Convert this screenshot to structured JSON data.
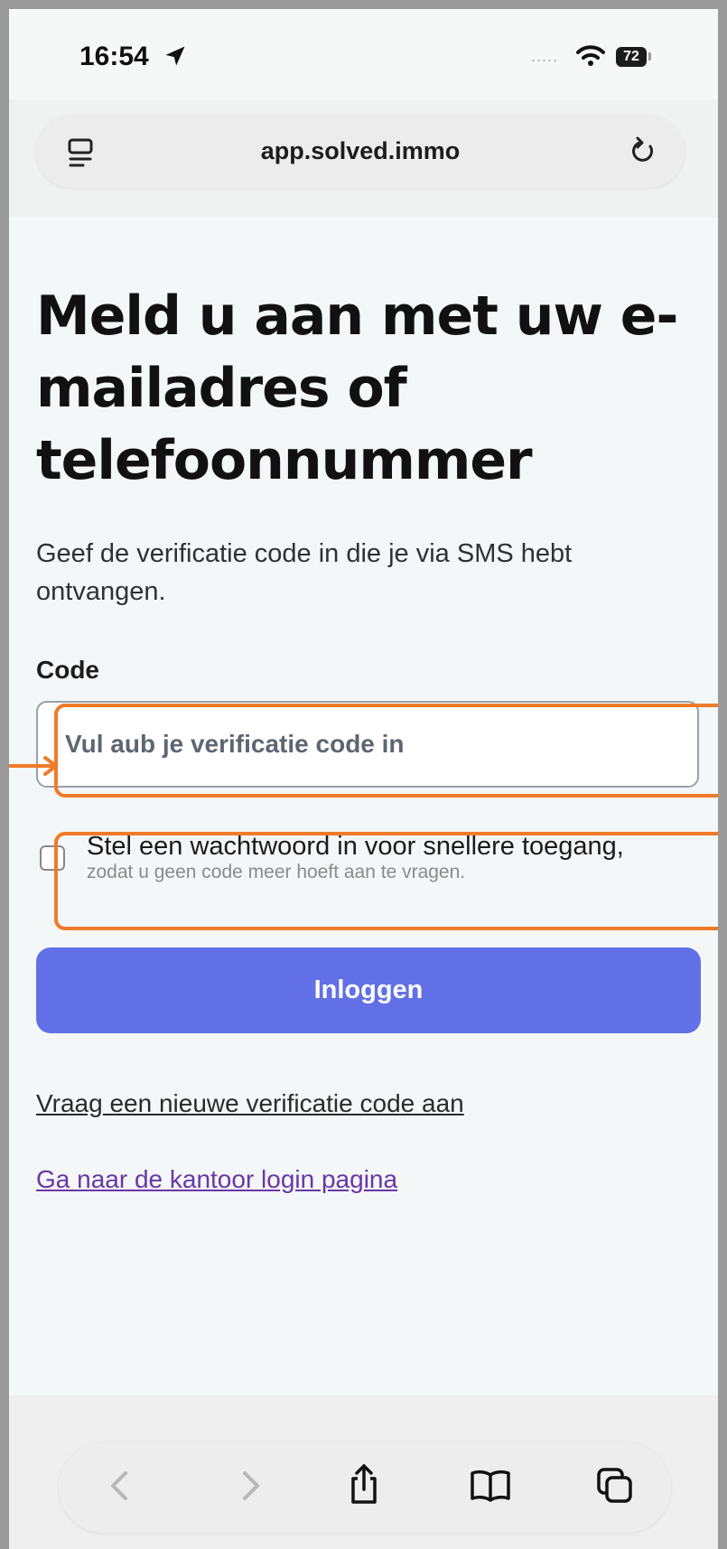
{
  "status_bar": {
    "time": "16:54",
    "signal": ".....",
    "battery": "72"
  },
  "browser": {
    "url": "app.solved.immo"
  },
  "page": {
    "title": "Meld u aan met uw e-mailadres of telefoonnummer",
    "subtitle": "Geef de verificatie code in die je via SMS hebt ontvangen.",
    "code_label": "Code",
    "code_placeholder": "Vul aub je verificatie code in",
    "checkbox_label": "Stel een wachtwoord in voor snellere toegang,",
    "checkbox_sublabel": "zodat u geen code meer hoeft aan te vragen.",
    "login_button": "Inloggen",
    "new_code_link": "Vraag een nieuwe verificatie code aan",
    "office_login_link": "Ga naar de kantoor login pagina"
  },
  "colors": {
    "accent": "#6170e6",
    "annotation": "#f07a2a",
    "link_visited": "#6a37a6"
  },
  "toolbar": {
    "icons": [
      "back-icon",
      "forward-icon",
      "share-icon",
      "bookmarks-icon",
      "tabs-icon"
    ]
  }
}
